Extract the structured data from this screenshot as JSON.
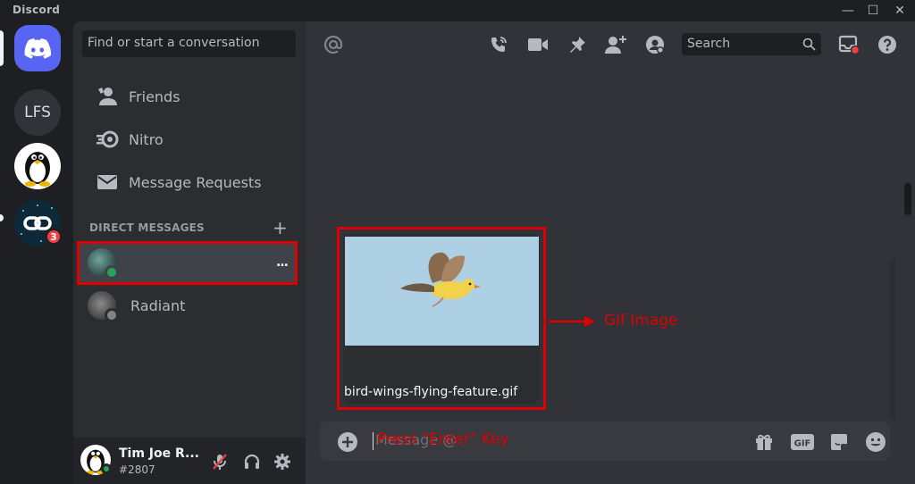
{
  "window": {
    "app_name": "Discord",
    "controls": {
      "minimize": "—",
      "maximize": "☐",
      "close": "✕"
    }
  },
  "guilds": [
    {
      "name": "Discord Home",
      "icon": "discord-logo-icon"
    },
    {
      "name": "LFS",
      "label": "LFS"
    },
    {
      "name": "Linux server",
      "icon": "tux-penguin-icon"
    },
    {
      "name": "Link server",
      "icon": "chain-link-icon",
      "badge": "3"
    }
  ],
  "sidebar": {
    "search_placeholder": "Find or start a conversation",
    "nav": [
      {
        "label": "Friends",
        "icon": "friends-icon"
      },
      {
        "label": "Nitro",
        "icon": "nitro-icon"
      },
      {
        "label": "Message Requests",
        "icon": "envelope-icon"
      }
    ],
    "dm_header": "DIRECT MESSAGES",
    "dm_add": "+",
    "dms": [
      {
        "name": "",
        "status": "online",
        "more": "..."
      },
      {
        "name": "Radiant",
        "status": "offline"
      }
    ]
  },
  "user": {
    "name": "Tim Joe R...",
    "tag": "#2807",
    "status": "online"
  },
  "header": {
    "search_placeholder": "Search",
    "icons": [
      "at-icon",
      "voice-call-icon",
      "video-call-icon",
      "pin-icon",
      "add-member-icon",
      "profile-icon",
      "search-icon",
      "inbox-icon",
      "help-icon"
    ]
  },
  "upload": {
    "filename": "bird-wings-flying-feature.gif"
  },
  "composer": {
    "placeholder": "Message @"
  },
  "annotations": {
    "gif_label": "Gif Image",
    "enter_label": "Press \"Enter\" Key",
    "color": "#e00000"
  },
  "colors": {
    "accent": "#5865f2",
    "online": "#23a55a",
    "badge": "#f23f43",
    "background": "#313338"
  }
}
